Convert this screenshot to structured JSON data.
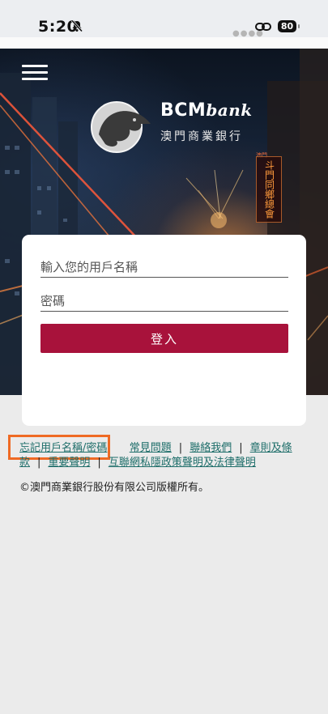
{
  "status_bar": {
    "time": "5:20",
    "battery": "80"
  },
  "hero": {
    "logo_en_main": "BCM",
    "logo_en_sub": "bank",
    "logo_cn": "澳門商業銀行",
    "neon_small": "澳門",
    "neon_sign": "斗門同鄉總會"
  },
  "login": {
    "username_placeholder": "輸入您的用戶名稱",
    "password_placeholder": "密碼",
    "login_label": "登入",
    "button_color": "#a8123b"
  },
  "footer": {
    "forgot_label": "忘記用戶名稱/密碼",
    "faq_label": "常見問題",
    "contact_label": "聯絡我們",
    "terms_label": "章則及條款",
    "notice_label": "重要聲明",
    "privacy_label": "互聯網私隱政策聲明及法律聲明",
    "separator": "|",
    "copyright": "©澳門商業銀行股份有限公司版權所有。",
    "link_color": "#1e6e6a",
    "highlight_color": "#ef6a24"
  }
}
